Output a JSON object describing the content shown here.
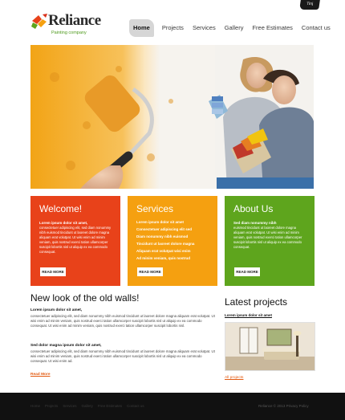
{
  "header": {
    "corner_label": "Tinj",
    "logo": {
      "name": "Reliance",
      "tagline": "Painting company"
    },
    "nav": [
      {
        "label": "Home",
        "active": true
      },
      {
        "label": "Projects",
        "active": false
      },
      {
        "label": "Services",
        "active": false
      },
      {
        "label": "Gallery",
        "active": false
      },
      {
        "label": "Free Estimates",
        "active": false
      },
      {
        "label": "Contact us",
        "active": false
      }
    ]
  },
  "panels": {
    "welcome": {
      "title": "Welcome!",
      "lead": "Lorem ipsum dolor sit amet,",
      "text": "consectetuer adipiscing elit, sed diam nonummy nibh euismod tincidunt ut laoreet dolore magna aliquam erat volutpat. Ut wisi enim ad minim veniam, quis nostrud exerci tation ullamcorper suscipit lobortis nisl ut aliquip ex ea commodo consequat.",
      "button": "READ MORE",
      "color": "#e8421a"
    },
    "services": {
      "title": "Services",
      "items": [
        "Lorem ipsum dolor sit amet",
        "Consectetuer adipiscing elit sed",
        "Diam nonummy nibh euismod",
        "Tincidunt ut laoreet dolore magna",
        "Aliquam erat volutpat wisi enim",
        "Ad minim veniam, quis nostrud"
      ],
      "button": "READ MORE",
      "color": "#f5a010"
    },
    "about": {
      "title": "About Us",
      "lead": "Sed diam nonummy nibh",
      "text": "euismod tincidunt ut laoreet dolore magna aliquam erat volutpat. Ut wisi enim ad minim veniam, quis nostrud exerci tation ullamcorper suscipit lobortis nisl ut aliquip ex ea commodo consequat.",
      "button": "READ MORE",
      "color": "#5ea51d"
    }
  },
  "main": {
    "heading": "New look of the old walls!",
    "lead1": "Lorem ipsum dolor sit amet,",
    "text1": "consectetuer adipiscing elit, sed diam nonummy nibh euismod tincidunt ut laoreet dolore magna aliquam erat volutpat. Ut wisi enim ad minim veniam, quis nostrud exerci tation ullamcorper suscipit lobortis nisl ut aliquip ex ea commodo consequat. Ut wisi enim ad minim veniam, quis nostrud exerci tation ullamcorper suscipit lobortis nisl.",
    "lead2": "Sed dolor magna ipsum dolor sit amet,",
    "text2": "consectetuer adipiscing elit, sed diam nonummy nibh euismod tincidunt ut laoreet dolore magna aliquam erat volutpat. Ut wisi enim ad minim veniam, quis nostrud exerci tation ullamcorper suscipit lobortis nisl ut aliquip ex ea commodo consequat. Ut wisi enim ad.",
    "read_more": "Read More"
  },
  "latest": {
    "heading": "Latest projects",
    "link": "Lorem ipsum dolor sit amet",
    "all": "All projects"
  },
  "footer": {
    "links": [
      "Home",
      "Projects",
      "Services",
      "Gallery",
      "Free Estimates",
      "Contact us"
    ],
    "copyright": "Reliance © 2013 Privacy Policy"
  },
  "colors": {
    "accent_orange": "#e35a10",
    "footer_bg": "#111111"
  }
}
